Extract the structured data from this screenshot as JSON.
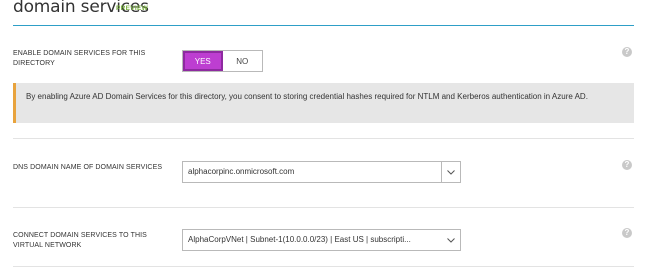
{
  "header": {
    "title": "domain services",
    "badge": "PREVIEW"
  },
  "enable": {
    "label_line1": "ENABLE DOMAIN SERVICES FOR THIS",
    "label_line2": "DIRECTORY",
    "yes_label": "YES",
    "no_label": "NO",
    "selected": "YES"
  },
  "notice": {
    "text": "By enabling Azure AD Domain Services for this directory, you consent to storing credential hashes required for NTLM and Kerberos authentication in Azure AD."
  },
  "dns": {
    "label": "DNS DOMAIN NAME OF DOMAIN SERVICES",
    "value": "alphacorpinc.onmicrosoft.com"
  },
  "network": {
    "label_line1": "CONNECT DOMAIN SERVICES TO THIS",
    "label_line2": "VIRTUAL NETWORK",
    "value": "AlphaCorpVNet | Subnet-1(10.0.0.0/23) | East US | subscripti..."
  },
  "help_glyph": "?",
  "colors": {
    "accent_line": "#2e9fc7",
    "toggle_on": "#bd3ed1",
    "notice_bar": "#e8a33d",
    "preview_badge": "#7cb342"
  }
}
